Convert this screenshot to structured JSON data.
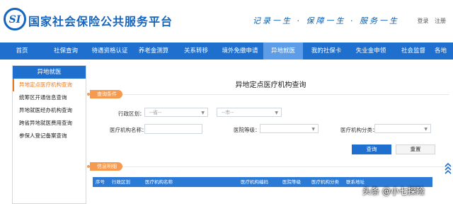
{
  "header": {
    "logo_text": "SI",
    "site_title": "国家社会保险公共服务平台",
    "slogan": "记录一生 · 保障一生 · 服务一生",
    "login": "登录",
    "register": "注册"
  },
  "nav": {
    "items": [
      "首页",
      "社保查询",
      "待遇资格认证",
      "养老金测算",
      "关系转移",
      "境外免缴申请",
      "异地就医",
      "我的社保卡",
      "失业金申领",
      "社会监督",
      "各地"
    ],
    "active_index": 6
  },
  "sidebar": {
    "header": "异地就医",
    "items": [
      "异地定点医疗机构查询",
      "统筹区开通信息查询",
      "异地就医经办机构查询",
      "跨省异地就医费用查询",
      "参保人登记备案查询"
    ],
    "active_index": 0
  },
  "main": {
    "title": "异地定点医疗机构查询",
    "query_section": "查询条件",
    "info_section": "信息明细",
    "form": {
      "region_label": "行政区划：",
      "region_select_1": "--省--",
      "region_select_2": "--市--",
      "name_label": "医疗机构名称：",
      "level_label": "医院等级：",
      "category_label": "医疗机构分类："
    },
    "buttons": {
      "query": "查询",
      "reset": "重置"
    },
    "table_headers": [
      "序号",
      "行政区划",
      "医疗机构名称",
      "医疗机构编码",
      "医院等级",
      "医疗机构分类",
      "联系地址"
    ]
  },
  "watermark": "头条 @小七探险",
  "colors": {
    "primary": "#1f6fcf",
    "accent": "#f59a4f",
    "nav_active": "#5d9ce6"
  }
}
